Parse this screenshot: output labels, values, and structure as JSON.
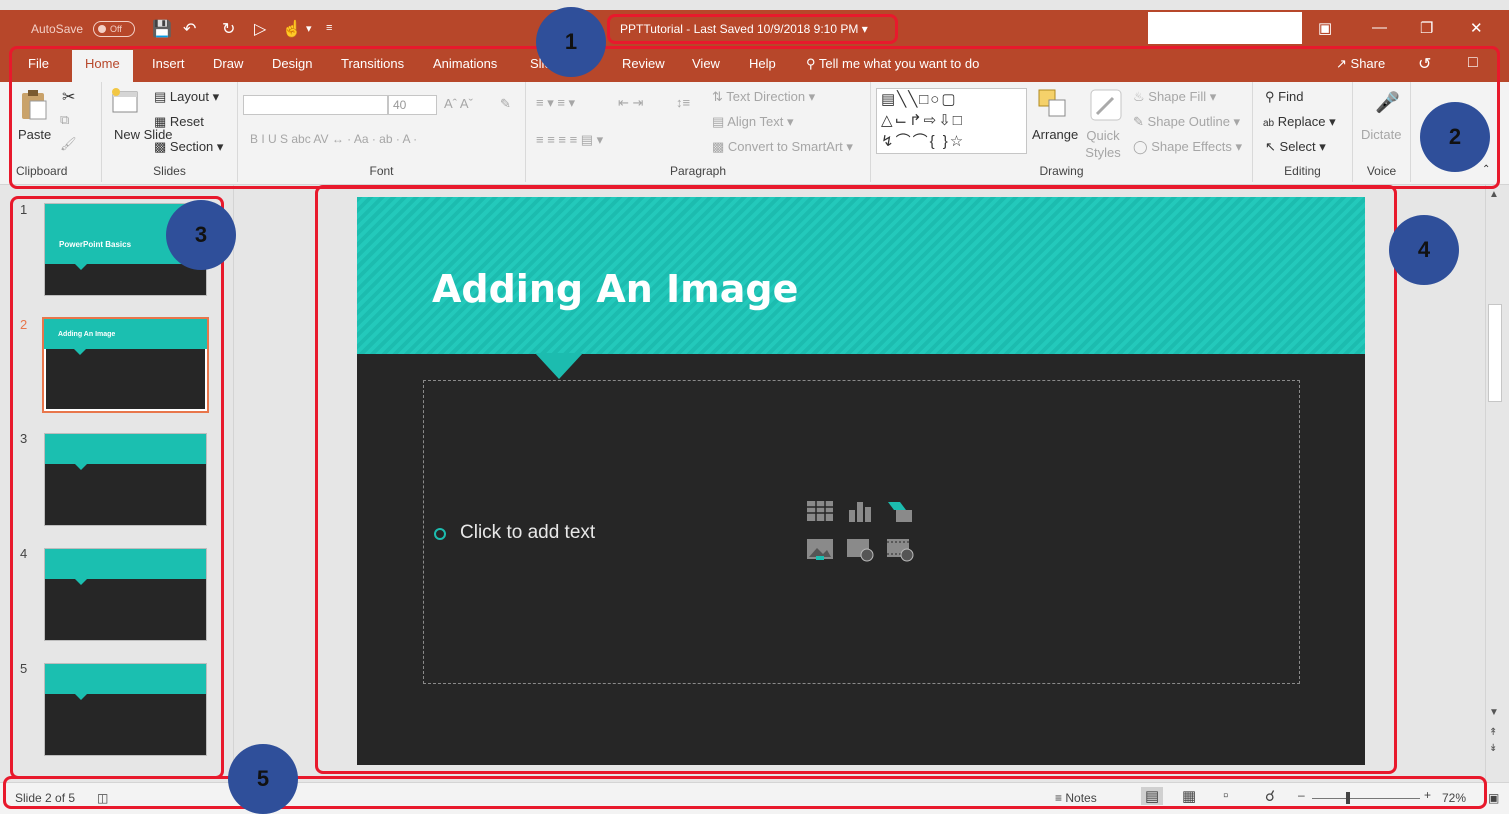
{
  "titlebar": {
    "autosave_label": "AutoSave",
    "autosave_state": "Off",
    "doc_title": "PPTTutorial  -  Last Saved 10/9/2018 9:10 PM  ▾"
  },
  "tabs": [
    {
      "label": "File"
    },
    {
      "label": "Home"
    },
    {
      "label": "Insert"
    },
    {
      "label": "Draw"
    },
    {
      "label": "Design"
    },
    {
      "label": "Transitions"
    },
    {
      "label": "Animations"
    },
    {
      "label": "Slide Show"
    },
    {
      "label": "Review"
    },
    {
      "label": "View"
    },
    {
      "label": "Help"
    }
  ],
  "tell_me": "Tell me what you want to do",
  "share": "Share",
  "ribbon": {
    "clipboard": {
      "paste": "Paste",
      "label": "Clipboard"
    },
    "slides": {
      "new_slide": "New Slide",
      "layout": "Layout",
      "reset": "Reset",
      "section": "Section",
      "label": "Slides"
    },
    "font": {
      "size": "40",
      "label": "Font",
      "row2": "B   I   U   S   abc  AV ↔ ·  Aa ·     ab ·  A ·"
    },
    "paragraph": {
      "text_direction": "Text Direction",
      "align_text": "Align Text",
      "convert_smartart": "Convert to SmartArt",
      "label": "Paragraph"
    },
    "drawing": {
      "arrange": "Arrange",
      "quick_styles": "Quick Styles",
      "shape_fill": "Shape Fill",
      "shape_outline": "Shape Outline",
      "shape_effects": "Shape Effects",
      "label": "Drawing"
    },
    "editing": {
      "find": "Find",
      "replace": "Replace",
      "select": "Select",
      "label": "Editing"
    },
    "voice": {
      "dictate": "Dictate",
      "label": "Voice"
    }
  },
  "thumbnails": [
    {
      "num": "1",
      "title": "PowerPoint Basics"
    },
    {
      "num": "2",
      "title": "Adding An Image"
    },
    {
      "num": "3",
      "title": ""
    },
    {
      "num": "4",
      "title": ""
    },
    {
      "num": "5",
      "title": ""
    }
  ],
  "slide": {
    "title": "Adding An Image",
    "placeholder_text": "Click to add text"
  },
  "statusbar": {
    "slide_indicator": "Slide 2 of 5",
    "notes": "Notes",
    "zoom": "72%"
  },
  "callouts": [
    "1",
    "2",
    "3",
    "4",
    "5"
  ],
  "colors": {
    "accent": "#b7472a",
    "slide_teal": "#1cbcaf",
    "slide_dark": "#262626",
    "annotation_red": "#e8192c",
    "callout_blue": "#2f4f9a"
  }
}
